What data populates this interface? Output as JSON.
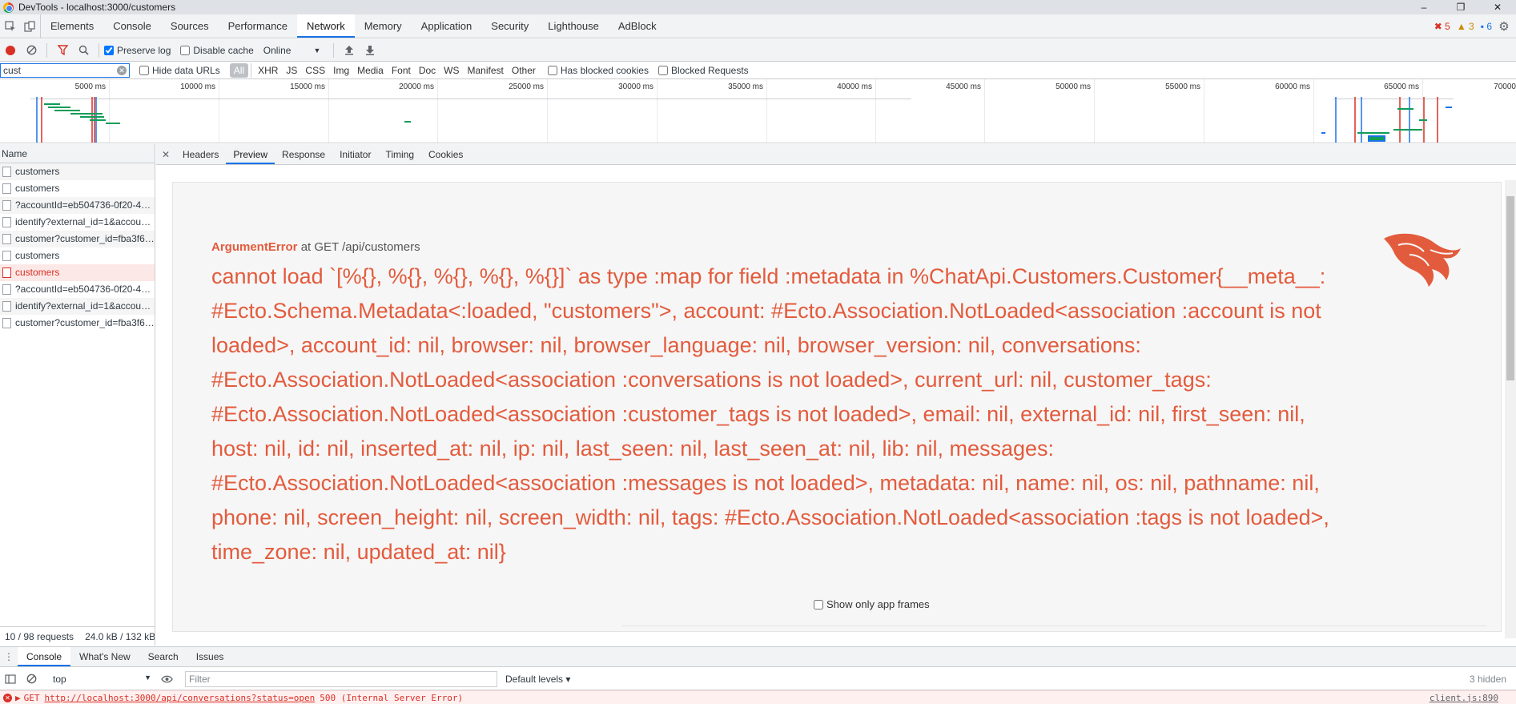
{
  "window": {
    "title": "DevTools - localhost:3000/customers",
    "controls": [
      "–",
      "❐",
      "✕"
    ]
  },
  "main_tabs": [
    "Elements",
    "Console",
    "Sources",
    "Performance",
    "Network",
    "Memory",
    "Application",
    "Security",
    "Lighthouse",
    "AdBlock"
  ],
  "active_main_tab": "Network",
  "issue_counts": {
    "errors": "5",
    "warnings": "3",
    "info": "6"
  },
  "network_toolbar": {
    "preserve_log": "Preserve log",
    "disable_cache": "Disable cache",
    "throttling": "Online"
  },
  "filter": {
    "value": "cust",
    "hide_data_urls": "Hide data URLs",
    "types": [
      "All",
      "XHR",
      "JS",
      "CSS",
      "Img",
      "Media",
      "Font",
      "Doc",
      "WS",
      "Manifest",
      "Other"
    ],
    "has_blocked_cookies": "Has blocked cookies",
    "blocked_requests": "Blocked Requests"
  },
  "overview": {
    "tick_labels": [
      "5000 ms",
      "10000 ms",
      "15000 ms",
      "20000 ms",
      "25000 ms",
      "30000 ms",
      "35000 ms",
      "40000 ms",
      "45000 ms",
      "50000 ms",
      "55000 ms",
      "60000 ms",
      "65000 ms",
      "70000"
    ]
  },
  "request_list": {
    "header": "Name",
    "rows": [
      {
        "name": "customers",
        "error": false
      },
      {
        "name": "customers",
        "error": false
      },
      {
        "name": "?accountId=eb504736-0f20-4…",
        "error": false
      },
      {
        "name": "identify?external_id=1&accou…",
        "error": false
      },
      {
        "name": "customer?customer_id=fba3f6…",
        "error": false
      },
      {
        "name": "customers",
        "error": false
      },
      {
        "name": "customers",
        "error": true
      },
      {
        "name": "?accountId=eb504736-0f20-4…",
        "error": false
      },
      {
        "name": "identify?external_id=1&accou…",
        "error": false
      },
      {
        "name": "customer?customer_id=fba3f6…",
        "error": false
      }
    ],
    "footer_requests": "10 / 98 requests",
    "footer_size": "24.0 kB / 132 kB"
  },
  "detail_tabs": [
    "Headers",
    "Preview",
    "Response",
    "Initiator",
    "Timing",
    "Cookies"
  ],
  "active_detail_tab": "Preview",
  "preview": {
    "error_name": "ArgumentError",
    "error_location": "at GET /api/customers",
    "message": "cannot load `[%{}, %{}, %{}, %{}, %{}]` as type :map for field :metadata in %ChatApi.Customers.Customer{__meta__: #Ecto.Schema.Metadata<:loaded, \"customers\">, account: #Ecto.Association.NotLoaded<association :account is not loaded>, account_id: nil, browser: nil, browser_language: nil, browser_version: nil, conversations: #Ecto.Association.NotLoaded<association :conversations is not loaded>, current_url: nil, customer_tags: #Ecto.Association.NotLoaded<association :customer_tags is not loaded>, email: nil, external_id: nil, first_seen: nil, host: nil, id: nil, inserted_at: nil, ip: nil, last_seen: nil, last_seen_at: nil, lib: nil, messages: #Ecto.Association.NotLoaded<association :messages is not loaded>, metadata: nil, name: nil, os: nil, pathname: nil, phone: nil, screen_height: nil, screen_width: nil, tags: #Ecto.Association.NotLoaded<association :tags is not loaded>, time_zone: nil, updated_at: nil}",
    "show_app_frames": "Show only app frames"
  },
  "drawer_tabs": [
    "Console",
    "What's New",
    "Search",
    "Issues"
  ],
  "active_drawer_tab": "Console",
  "console": {
    "context": "top",
    "filter_placeholder": "Filter",
    "levels": "Default levels ▾",
    "hidden": "3 hidden",
    "message_method": "GET",
    "message_url": "http://localhost:3000/api/conversations?status=open",
    "message_status": "500 (Internal Server Error)",
    "message_source": "client.js:890"
  },
  "colors": {
    "accent": "#1a73e8",
    "error": "#d93025",
    "phoenix_orange": "#e35b3d"
  }
}
